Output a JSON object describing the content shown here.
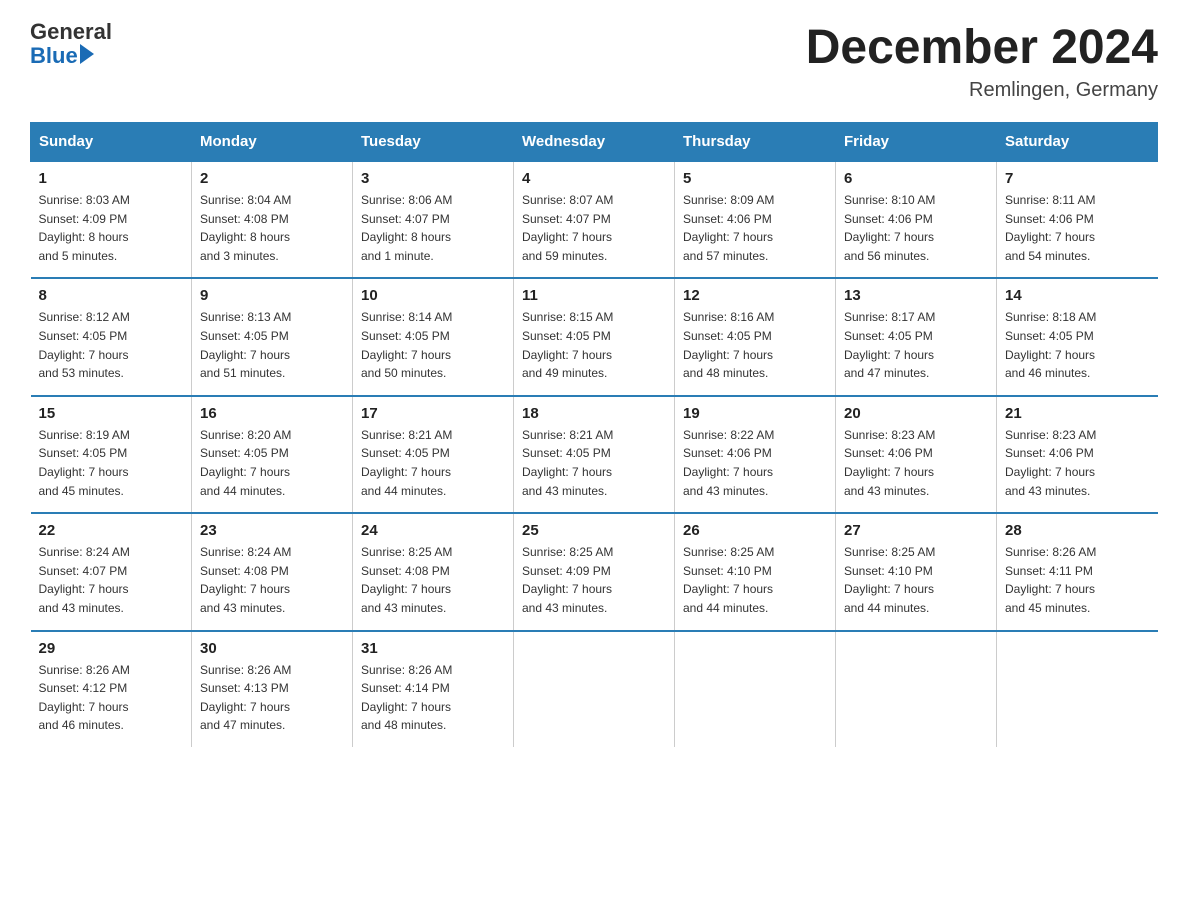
{
  "header": {
    "logo": {
      "general": "General",
      "blue": "Blue"
    },
    "title": "December 2024",
    "location": "Remlingen, Germany"
  },
  "days_of_week": [
    "Sunday",
    "Monday",
    "Tuesday",
    "Wednesday",
    "Thursday",
    "Friday",
    "Saturday"
  ],
  "weeks": [
    [
      {
        "day": "1",
        "info": "Sunrise: 8:03 AM\nSunset: 4:09 PM\nDaylight: 8 hours\nand 5 minutes."
      },
      {
        "day": "2",
        "info": "Sunrise: 8:04 AM\nSunset: 4:08 PM\nDaylight: 8 hours\nand 3 minutes."
      },
      {
        "day": "3",
        "info": "Sunrise: 8:06 AM\nSunset: 4:07 PM\nDaylight: 8 hours\nand 1 minute."
      },
      {
        "day": "4",
        "info": "Sunrise: 8:07 AM\nSunset: 4:07 PM\nDaylight: 7 hours\nand 59 minutes."
      },
      {
        "day": "5",
        "info": "Sunrise: 8:09 AM\nSunset: 4:06 PM\nDaylight: 7 hours\nand 57 minutes."
      },
      {
        "day": "6",
        "info": "Sunrise: 8:10 AM\nSunset: 4:06 PM\nDaylight: 7 hours\nand 56 minutes."
      },
      {
        "day": "7",
        "info": "Sunrise: 8:11 AM\nSunset: 4:06 PM\nDaylight: 7 hours\nand 54 minutes."
      }
    ],
    [
      {
        "day": "8",
        "info": "Sunrise: 8:12 AM\nSunset: 4:05 PM\nDaylight: 7 hours\nand 53 minutes."
      },
      {
        "day": "9",
        "info": "Sunrise: 8:13 AM\nSunset: 4:05 PM\nDaylight: 7 hours\nand 51 minutes."
      },
      {
        "day": "10",
        "info": "Sunrise: 8:14 AM\nSunset: 4:05 PM\nDaylight: 7 hours\nand 50 minutes."
      },
      {
        "day": "11",
        "info": "Sunrise: 8:15 AM\nSunset: 4:05 PM\nDaylight: 7 hours\nand 49 minutes."
      },
      {
        "day": "12",
        "info": "Sunrise: 8:16 AM\nSunset: 4:05 PM\nDaylight: 7 hours\nand 48 minutes."
      },
      {
        "day": "13",
        "info": "Sunrise: 8:17 AM\nSunset: 4:05 PM\nDaylight: 7 hours\nand 47 minutes."
      },
      {
        "day": "14",
        "info": "Sunrise: 8:18 AM\nSunset: 4:05 PM\nDaylight: 7 hours\nand 46 minutes."
      }
    ],
    [
      {
        "day": "15",
        "info": "Sunrise: 8:19 AM\nSunset: 4:05 PM\nDaylight: 7 hours\nand 45 minutes."
      },
      {
        "day": "16",
        "info": "Sunrise: 8:20 AM\nSunset: 4:05 PM\nDaylight: 7 hours\nand 44 minutes."
      },
      {
        "day": "17",
        "info": "Sunrise: 8:21 AM\nSunset: 4:05 PM\nDaylight: 7 hours\nand 44 minutes."
      },
      {
        "day": "18",
        "info": "Sunrise: 8:21 AM\nSunset: 4:05 PM\nDaylight: 7 hours\nand 43 minutes."
      },
      {
        "day": "19",
        "info": "Sunrise: 8:22 AM\nSunset: 4:06 PM\nDaylight: 7 hours\nand 43 minutes."
      },
      {
        "day": "20",
        "info": "Sunrise: 8:23 AM\nSunset: 4:06 PM\nDaylight: 7 hours\nand 43 minutes."
      },
      {
        "day": "21",
        "info": "Sunrise: 8:23 AM\nSunset: 4:06 PM\nDaylight: 7 hours\nand 43 minutes."
      }
    ],
    [
      {
        "day": "22",
        "info": "Sunrise: 8:24 AM\nSunset: 4:07 PM\nDaylight: 7 hours\nand 43 minutes."
      },
      {
        "day": "23",
        "info": "Sunrise: 8:24 AM\nSunset: 4:08 PM\nDaylight: 7 hours\nand 43 minutes."
      },
      {
        "day": "24",
        "info": "Sunrise: 8:25 AM\nSunset: 4:08 PM\nDaylight: 7 hours\nand 43 minutes."
      },
      {
        "day": "25",
        "info": "Sunrise: 8:25 AM\nSunset: 4:09 PM\nDaylight: 7 hours\nand 43 minutes."
      },
      {
        "day": "26",
        "info": "Sunrise: 8:25 AM\nSunset: 4:10 PM\nDaylight: 7 hours\nand 44 minutes."
      },
      {
        "day": "27",
        "info": "Sunrise: 8:25 AM\nSunset: 4:10 PM\nDaylight: 7 hours\nand 44 minutes."
      },
      {
        "day": "28",
        "info": "Sunrise: 8:26 AM\nSunset: 4:11 PM\nDaylight: 7 hours\nand 45 minutes."
      }
    ],
    [
      {
        "day": "29",
        "info": "Sunrise: 8:26 AM\nSunset: 4:12 PM\nDaylight: 7 hours\nand 46 minutes."
      },
      {
        "day": "30",
        "info": "Sunrise: 8:26 AM\nSunset: 4:13 PM\nDaylight: 7 hours\nand 47 minutes."
      },
      {
        "day": "31",
        "info": "Sunrise: 8:26 AM\nSunset: 4:14 PM\nDaylight: 7 hours\nand 48 minutes."
      },
      null,
      null,
      null,
      null
    ]
  ]
}
